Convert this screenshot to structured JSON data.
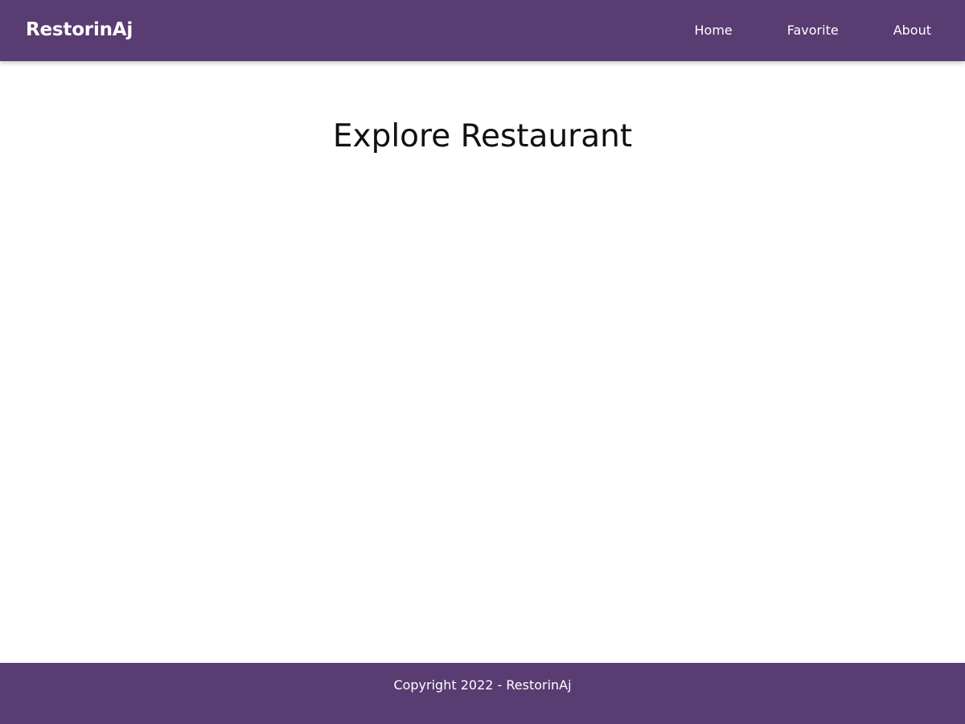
{
  "colors": {
    "primary": "#583c72",
    "on_primary": "#ffffff",
    "background": "#ffffff",
    "text": "#111111"
  },
  "header": {
    "brand": "RestorinAj",
    "nav": [
      {
        "label": "Home"
      },
      {
        "label": "Favorite"
      },
      {
        "label": "About"
      }
    ]
  },
  "main": {
    "title": "Explore Restaurant"
  },
  "footer": {
    "copyright": "Copyright 2022 - RestorinAj"
  }
}
